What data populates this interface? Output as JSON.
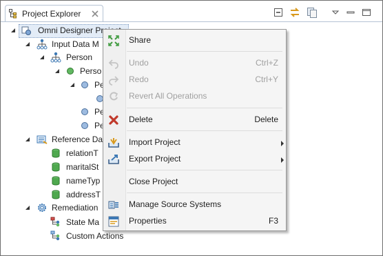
{
  "view": {
    "tab_title": "Project Explorer"
  },
  "tree": {
    "root": "Omni Designer Project",
    "input_data": "Input Data M",
    "person": "Person",
    "person_child": "Perso",
    "p_item_1": "Pe",
    "p_item_2": "Pe",
    "p_item_3": "Pe",
    "reference_data": "Reference Da",
    "relation": "relationT",
    "marital": "maritalSt",
    "nametype": "nameTyp",
    "address": "addressT",
    "remediation": "Remediation",
    "state_ma": "State Ma",
    "custom_actions": "Custom Actions"
  },
  "menu": {
    "share": "Share",
    "undo": "Undo",
    "undo_key": "Ctrl+Z",
    "redo": "Redo",
    "redo_key": "Ctrl+Y",
    "revert": "Revert All Operations",
    "delete": "Delete",
    "delete_key": "Delete",
    "import": "Import Project",
    "export": "Export Project",
    "close": "Close Project",
    "manage": "Manage Source Systems",
    "properties": "Properties",
    "properties_key": "F3"
  },
  "colors": {
    "accent_blue": "#3c78b4",
    "delete_red": "#c0392b",
    "tree_green": "#3f9a3f"
  }
}
